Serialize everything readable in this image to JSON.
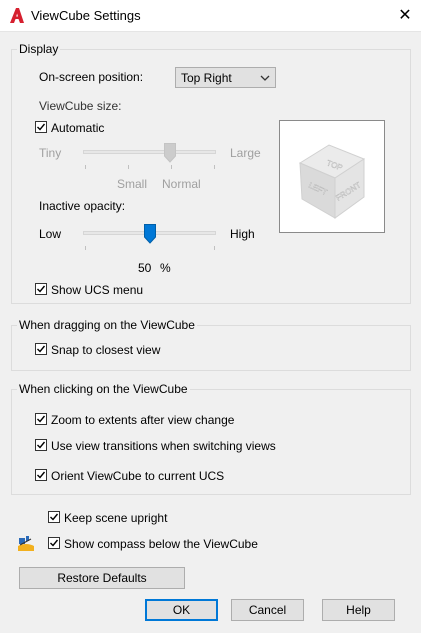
{
  "window": {
    "title": "ViewCube Settings",
    "close_symbol": "✕"
  },
  "display": {
    "legend": "Display",
    "onscreen_label": "On-screen position:",
    "onscreen_value": "Top Right",
    "size_label": "ViewCube size:",
    "automatic_label": "Automatic",
    "automatic_checked": true,
    "size_min_label": "Tiny",
    "size_max_label": "Large",
    "size_small_tick": "Small",
    "size_normal_tick": "Normal",
    "size_level": "Normal",
    "opacity_label": "Inactive opacity:",
    "opacity_min_label": "Low",
    "opacity_max_label": "High",
    "opacity_value": "50",
    "opacity_unit": "%",
    "show_ucs_label": "Show UCS menu",
    "show_ucs_checked": true,
    "cube_faces": {
      "top": "TOP",
      "left": "LEFT",
      "front": "FRONT"
    }
  },
  "dragging": {
    "legend": "When dragging on the ViewCube",
    "snap_label": "Snap to closest view",
    "snap_checked": true
  },
  "clicking": {
    "legend": "When clicking on the ViewCube",
    "zoom_label": "Zoom to extents after view change",
    "zoom_checked": true,
    "transitions_label": "Use view transitions when switching views",
    "transitions_checked": true,
    "orient_label": "Orient ViewCube to current UCS",
    "orient_checked": true
  },
  "keep_upright_label": "Keep scene upright",
  "keep_upright_checked": true,
  "compass_label": "Show compass below the ViewCube",
  "compass_checked": true,
  "buttons": {
    "restore": "Restore Defaults",
    "ok": "OK",
    "cancel": "Cancel",
    "help": "Help"
  },
  "colors": {
    "accent": "#0078d7",
    "app_icon": "#d6202f"
  }
}
